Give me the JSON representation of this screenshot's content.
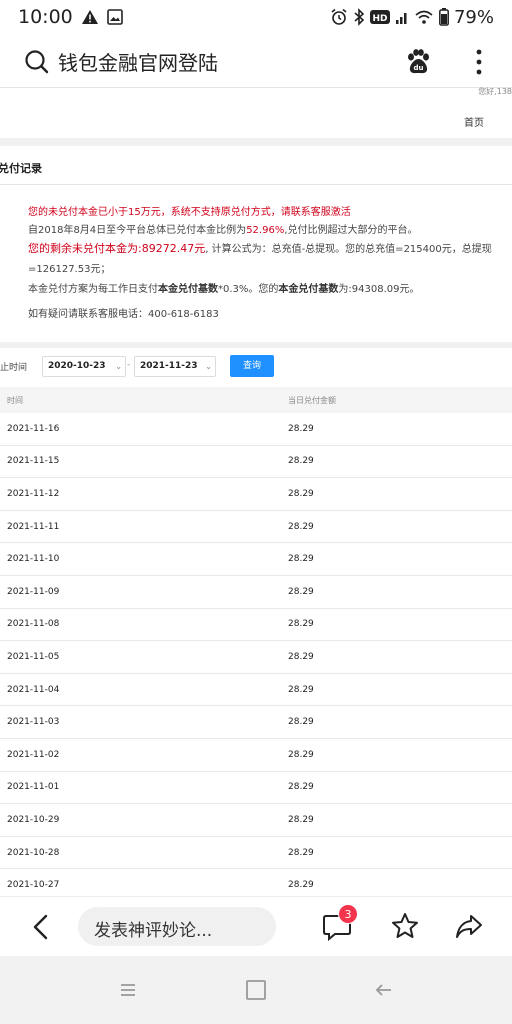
{
  "status": {
    "time": "10:00",
    "battery": "79%"
  },
  "search": {
    "query": "钱包金融官网登陆"
  },
  "page": {
    "greeting": "您好,138",
    "home_link": "首页"
  },
  "record": {
    "title": "兑付记录",
    "line1": "您的未兑付本金已小于15万元，系统不支持原兑付方式，请联系客服激活",
    "line2_a": "自2018年8月4日至今平台总体已兑付本金比例为",
    "line2_pct": "52.96%",
    "line2_b": ",兑付比例超过大部分的平台。",
    "line3_a": "您的剩余未兑付本金为:",
    "line3_amount": "89272.47元",
    "line3_b": ", 计算公式为：总充值-总提现。您的总充值=215400元，总提现",
    "line4": "=126127.53元；",
    "line5_a": "本金兑付方案为每工作日支付",
    "line5_bold1": "本金兑付基数",
    "line5_b": "*0.3%。您的",
    "line5_bold2": "本金兑付基数",
    "line5_c": "为:94308.09元。",
    "line6": "如有疑问请联系客服电话：400-618-6183"
  },
  "filter": {
    "label": "起止时间",
    "start": "2020-10-23",
    "end": "2021-11-23",
    "button": "查询"
  },
  "table": {
    "headers": [
      "时间",
      "当日兑付金额"
    ],
    "rows": [
      [
        "2021-11-16",
        "28.29"
      ],
      [
        "2021-11-15",
        "28.29"
      ],
      [
        "2021-11-12",
        "28.29"
      ],
      [
        "2021-11-11",
        "28.29"
      ],
      [
        "2021-11-10",
        "28.29"
      ],
      [
        "2021-11-09",
        "28.29"
      ],
      [
        "2021-11-08",
        "28.29"
      ],
      [
        "2021-11-05",
        "28.29"
      ],
      [
        "2021-11-04",
        "28.29"
      ],
      [
        "2021-11-03",
        "28.29"
      ],
      [
        "2021-11-02",
        "28.29"
      ],
      [
        "2021-11-01",
        "28.29"
      ],
      [
        "2021-10-29",
        "28.29"
      ],
      [
        "2021-10-28",
        "28.29"
      ],
      [
        "2021-10-27",
        "28.29"
      ]
    ]
  },
  "bottom": {
    "comment_placeholder": "发表神评妙论...",
    "comment_count": "3"
  },
  "colors": {
    "accent": "#1e90ff",
    "warning": "#d0021b",
    "badge": "#f2344c"
  }
}
